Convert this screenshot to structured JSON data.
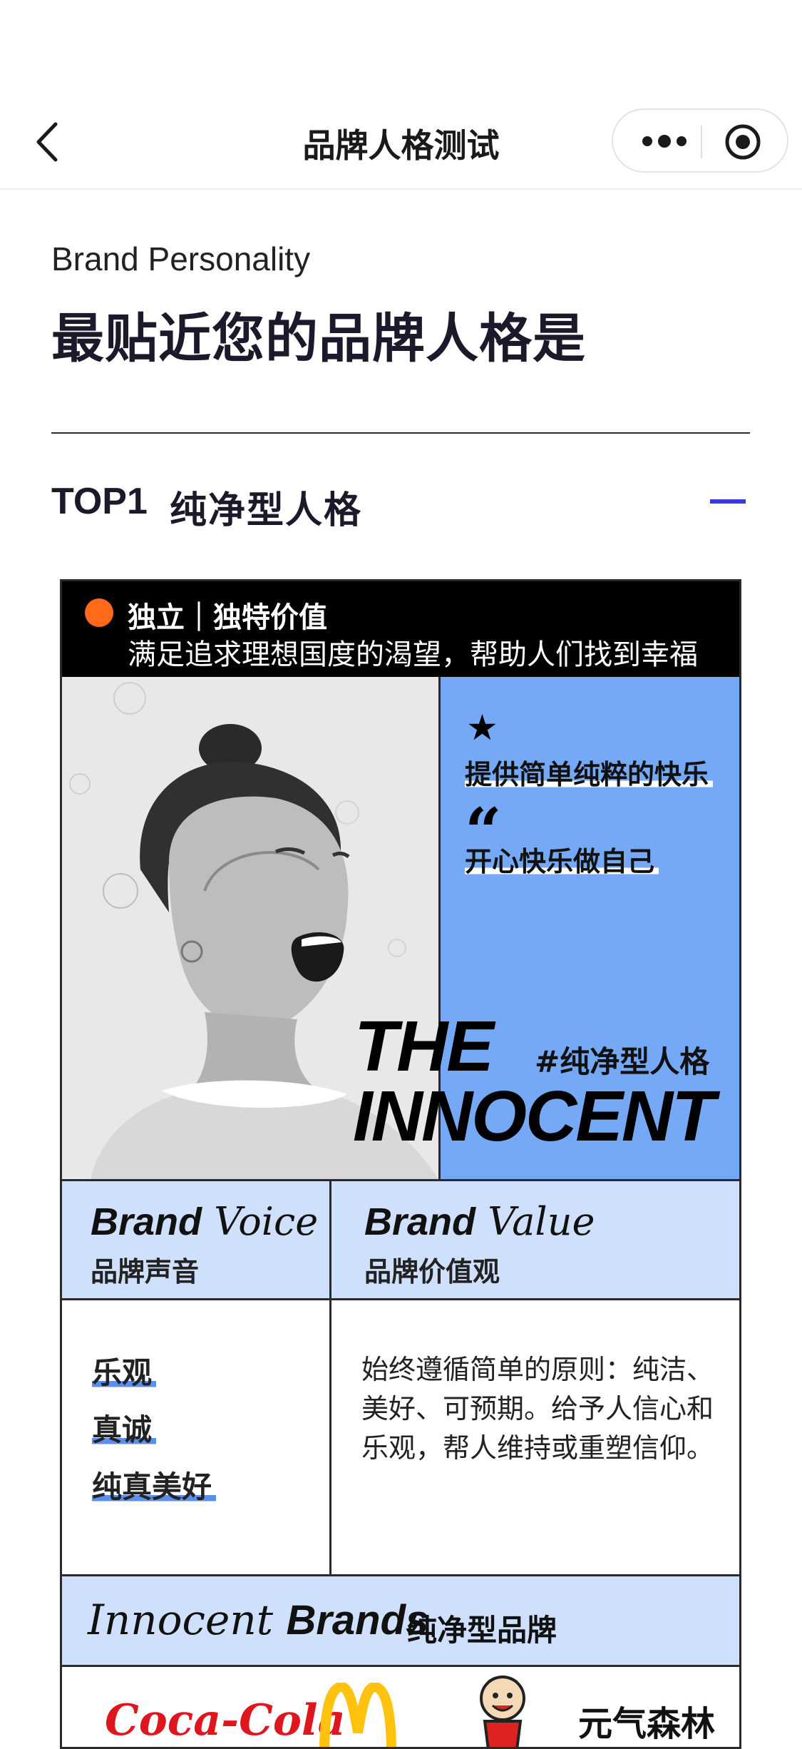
{
  "nav": {
    "title": "品牌人格测试",
    "icons": [
      "back-chevron-icon",
      "more-dots-icon",
      "target-icon"
    ]
  },
  "intro": {
    "subtitle_en": "Brand Personality",
    "title_zh": "最贴近您的品牌人格是"
  },
  "result": {
    "rank_label": "TOP1",
    "personality_name": "纯净型人格"
  },
  "card": {
    "header_line1": "独立｜独特价值",
    "header_line2": "满足追求理想国度的渴望，帮助人们找到幸福",
    "highlight_1": "提供简单纯粹的快乐",
    "highlight_2": "开心快乐做自己",
    "hashtag": "#纯净型人格",
    "big_title_1": "THE",
    "big_title_2": "INNOCENT",
    "voice": {
      "head_bold": "Brand",
      "head_italic": "Voice",
      "sub": "品牌声音",
      "traits": [
        "乐观",
        "真诚",
        "纯真美好"
      ]
    },
    "value": {
      "head_bold": "Brand",
      "head_italic": "Value",
      "sub": "品牌价值观",
      "text": "始终遵循简单的原则：纯洁、美好、可预期。给予人信心和乐观，帮人维持或重塑信仰。"
    },
    "brands": {
      "head_italic": "Innocent",
      "head_bold": "Brands",
      "sub": "纯净型品牌",
      "logos": [
        "Coca-Cola",
        "McDonald's",
        "want-want-kid-logo",
        "元气森林"
      ]
    },
    "colors": {
      "accent_blue": "#76a9f5",
      "light_blue": "#cfe0fc",
      "orange_dot": "#ff6a1a",
      "collapse_bar": "#3a3adc"
    }
  }
}
